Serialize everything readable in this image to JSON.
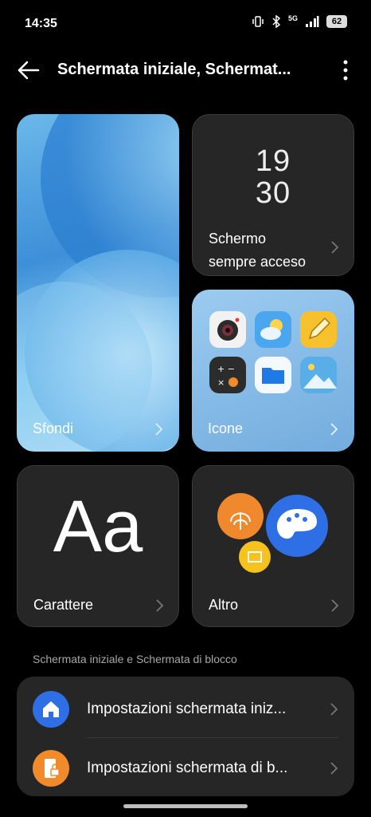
{
  "status_bar": {
    "time": "14:35",
    "network": "5G",
    "battery": "62"
  },
  "header": {
    "title": "Schermata iniziale, Schermat..."
  },
  "cards": {
    "wallpapers": {
      "label": "Sfondi"
    },
    "always_on": {
      "label_line1": "Schermo",
      "label_line2": "sempre acceso",
      "clock_hours": "19",
      "clock_minutes": "30"
    },
    "icons": {
      "label": "Icone"
    },
    "font": {
      "label": "Carattere",
      "sample": "Aa"
    },
    "more": {
      "label": "Altro"
    }
  },
  "section": {
    "title": "Schermata iniziale e Schermata di blocco",
    "items": [
      {
        "label": "Impostazioni schermata iniz...",
        "icon": "home-icon",
        "color": "#2f6fe6"
      },
      {
        "label": "Impostazioni schermata di b...",
        "icon": "phone-lock-icon",
        "color": "#f08a2a"
      }
    ]
  },
  "colors": {
    "accent_blue": "#2f6fe6",
    "accent_orange": "#f08a2a",
    "card_bg": "#262626"
  }
}
